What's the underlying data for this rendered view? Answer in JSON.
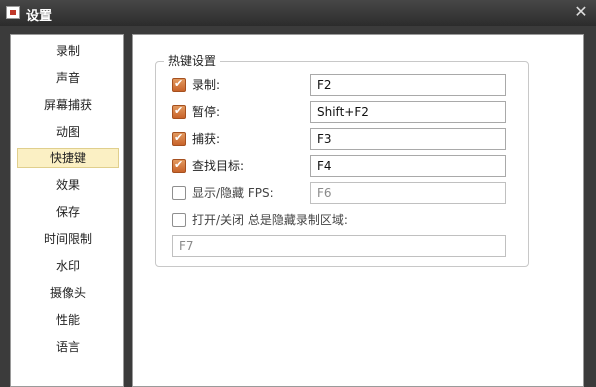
{
  "window": {
    "title": "设置"
  },
  "sidebar": {
    "items": [
      {
        "label": "录制"
      },
      {
        "label": "声音"
      },
      {
        "label": "屏幕捕获"
      },
      {
        "label": "动图"
      },
      {
        "label": "快捷键",
        "selected": true
      },
      {
        "label": "效果"
      },
      {
        "label": "保存"
      },
      {
        "label": "时间限制"
      },
      {
        "label": "水印"
      },
      {
        "label": "摄像头"
      },
      {
        "label": "性能"
      },
      {
        "label": "语言"
      }
    ]
  },
  "hotkeys": {
    "group_title": "热键设置",
    "rows": [
      {
        "label": "录制:",
        "value": "F2",
        "checked": true
      },
      {
        "label": "暂停:",
        "value": "Shift+F2",
        "checked": true
      },
      {
        "label": "捕获:",
        "value": "F3",
        "checked": true
      },
      {
        "label": "查找目标:",
        "value": "F4",
        "checked": true
      },
      {
        "label": "显示/隐藏 FPS:",
        "value": "F6",
        "checked": false
      }
    ],
    "extra": {
      "label": "打开/关闭 总是隐藏录制区域:",
      "value": "F7",
      "checked": false
    }
  },
  "colors": {
    "accent_check": "#c8632a",
    "selected_item_bg": "#fbf0c4",
    "titlebar": "#2c2c2c"
  },
  "icons": {
    "app": "app-icon",
    "close": "close-icon"
  }
}
